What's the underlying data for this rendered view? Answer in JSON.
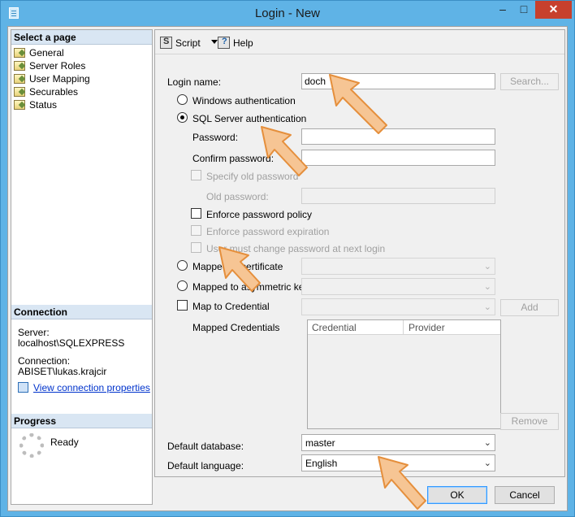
{
  "window": {
    "title": "Login - New",
    "minimize": "–",
    "maximize": "□",
    "close": "✕"
  },
  "sidebar": {
    "select_page_header": "Select a page",
    "pages": [
      {
        "label": "General",
        "icon": "page-icon"
      },
      {
        "label": "Server Roles",
        "icon": "page-icon"
      },
      {
        "label": "User Mapping",
        "icon": "page-icon"
      },
      {
        "label": "Securables",
        "icon": "page-icon"
      },
      {
        "label": "Status",
        "icon": "page-icon"
      }
    ],
    "connection_header": "Connection",
    "server_label": "Server:",
    "server_value": "localhost\\SQLEXPRESS",
    "connection_label": "Connection:",
    "connection_value": "ABISET\\lukas.krajcir",
    "view_connection_properties": "View connection properties",
    "progress_header": "Progress",
    "progress_status": "Ready"
  },
  "toolbar": {
    "script_label": "Script",
    "help_label": "Help"
  },
  "form": {
    "login_name_label": "Login name:",
    "login_name_value": "doch",
    "search_button": "Search...",
    "windows_auth": "Windows authentication",
    "sql_auth": "SQL Server authentication",
    "password_label": "Password:",
    "confirm_password_label": "Confirm password:",
    "specify_old_password": "Specify old password",
    "old_password_label": "Old password:",
    "enforce_policy": "Enforce password policy",
    "enforce_expiration": "Enforce password expiration",
    "must_change": "User must change password at next login",
    "mapped_to_certificate": "Mapped to certificate",
    "mapped_to_asym_key": "Mapped to asymmetric key",
    "map_to_credential": "Map to Credential",
    "add_button": "Add",
    "mapped_credentials_label": "Mapped Credentials",
    "credential_col": "Credential",
    "provider_col": "Provider",
    "remove_button": "Remove",
    "default_database_label": "Default database:",
    "default_database_value": "master",
    "default_language_label": "Default language:",
    "default_language_value": "English"
  },
  "footer": {
    "ok": "OK",
    "cancel": "Cancel"
  },
  "colors": {
    "titlebar": "#5fb3e6",
    "close_button": "#c7402d",
    "arrow_fill": "#f6c594",
    "arrow_stroke": "#e58f3c"
  }
}
